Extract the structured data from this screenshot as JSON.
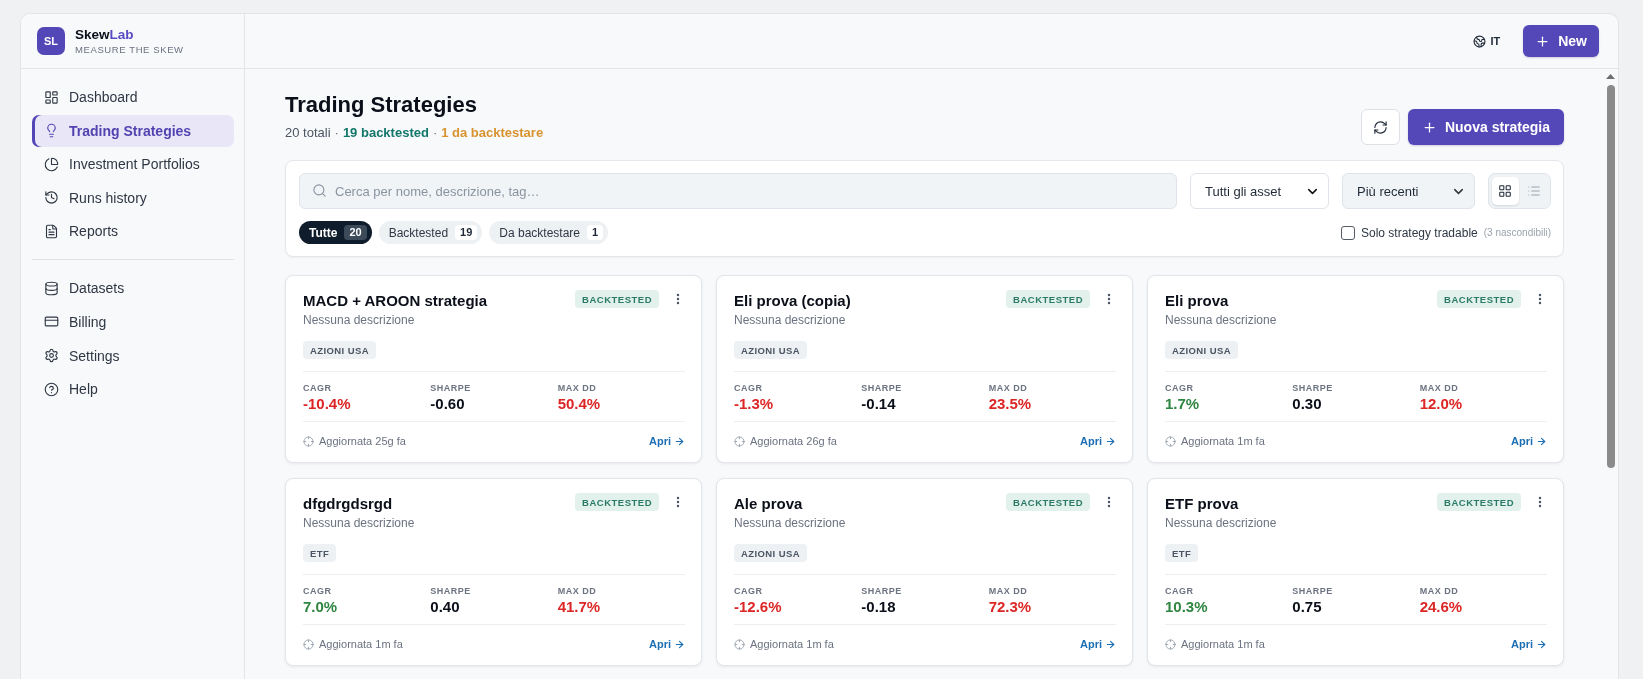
{
  "sidebar": {
    "brand": {
      "logo": "SL",
      "name": "Skew",
      "name_accent": "Lab",
      "tagline": "MEASURE THE SKEW"
    },
    "nav_groups": [
      {
        "items": [
          {
            "label": "Dashboard",
            "selected": false
          },
          {
            "label": "Trading Strategies",
            "selected": true
          },
          {
            "label": "Investment Portfolios",
            "selected": false
          },
          {
            "label": "Runs history",
            "selected": false
          },
          {
            "label": "Reports",
            "selected": false
          }
        ]
      },
      {
        "items": [
          {
            "label": "Datasets",
            "selected": false
          },
          {
            "label": "Billing",
            "selected": false
          },
          {
            "label": "Settings",
            "selected": false
          },
          {
            "label": "Help",
            "selected": false
          }
        ]
      }
    ]
  },
  "topbar": {
    "language": "IT",
    "new_button": "New"
  },
  "page": {
    "title": "Trading Strategies",
    "summary": {
      "separator": "·",
      "parts": [
        {
          "kind": "total",
          "text": "20 totali"
        },
        {
          "kind": "backtested",
          "text": "19 backtested"
        },
        {
          "kind": "pending",
          "text": "1 da backtestare"
        }
      ]
    },
    "new_strategy_button": "Nuova strategia"
  },
  "filters": {
    "search": {
      "placeholder": "Cerca per nome, descrizione, tag…"
    },
    "asset_filter": {
      "value": "Tutti gli asset"
    },
    "sort": {
      "value": "Più recenti"
    },
    "view_modes": [
      {
        "kind": "grid",
        "selected": true
      },
      {
        "kind": "list",
        "selected": false
      }
    ],
    "status_chips": [
      {
        "label": "Tutte",
        "count": "20",
        "selected": true
      },
      {
        "label": "Backtested",
        "count": "19",
        "selected": false
      },
      {
        "label": "Da backtestare",
        "count": "1",
        "selected": false
      }
    ],
    "tradable_filter": {
      "label": "Solo strategy tradable",
      "hint": "(3 nascondibili)",
      "checked": false
    }
  },
  "cards": [
    {
      "title": "MACD + AROON strategia",
      "description": "Nessuna descrizione",
      "status": {
        "kind": "backtested",
        "label": "BACKTESTED"
      },
      "tags": [
        "AZIONI USA"
      ],
      "metrics": [
        {
          "label": "CAGR",
          "value": "-10.4%",
          "color": "#dc2626"
        },
        {
          "label": "SHARPE",
          "value": "-0.60",
          "color": "#0b0f19"
        },
        {
          "label": "MAX DD",
          "value": "50.4%",
          "color": "#dc2626"
        }
      ],
      "updated": "Aggiornata 25g fa",
      "link": "Apri"
    },
    {
      "title": "Eli prova (copia)",
      "description": "Nessuna descrizione",
      "status": {
        "kind": "backtested",
        "label": "BACKTESTED"
      },
      "tags": [
        "AZIONI USA"
      ],
      "metrics": [
        {
          "label": "CAGR",
          "value": "-1.3%",
          "color": "#dc2626"
        },
        {
          "label": "SHARPE",
          "value": "-0.14",
          "color": "#0b0f19"
        },
        {
          "label": "MAX DD",
          "value": "23.5%",
          "color": "#dc2626"
        }
      ],
      "updated": "Aggiornata 26g fa",
      "link": "Apri"
    },
    {
      "title": "Eli prova",
      "description": "Nessuna descrizione",
      "status": {
        "kind": "backtested",
        "label": "BACKTESTED"
      },
      "tags": [
        "AZIONI USA"
      ],
      "metrics": [
        {
          "label": "CAGR",
          "value": "1.7%",
          "color": "#2e8540"
        },
        {
          "label": "SHARPE",
          "value": "0.30",
          "color": "#0b0f19"
        },
        {
          "label": "MAX DD",
          "value": "12.0%",
          "color": "#dc2626"
        }
      ],
      "updated": "Aggiornata 1m fa",
      "link": "Apri"
    },
    {
      "title": "dfgdrgdsrgd",
      "description": "Nessuna descrizione",
      "status": {
        "kind": "backtested",
        "label": "BACKTESTED"
      },
      "tags": [
        "ETF"
      ],
      "metrics": [
        {
          "label": "CAGR",
          "value": "7.0%",
          "color": "#2e8540"
        },
        {
          "label": "SHARPE",
          "value": "0.40",
          "color": "#0b0f19"
        },
        {
          "label": "MAX DD",
          "value": "41.7%",
          "color": "#dc2626"
        }
      ],
      "updated": "Aggiornata 1m fa",
      "link": "Apri"
    },
    {
      "title": "Ale prova",
      "description": "Nessuna descrizione",
      "status": {
        "kind": "backtested",
        "label": "BACKTESTED"
      },
      "tags": [
        "AZIONI USA"
      ],
      "metrics": [
        {
          "label": "CAGR",
          "value": "-12.6%",
          "color": "#dc2626"
        },
        {
          "label": "SHARPE",
          "value": "-0.18",
          "color": "#0b0f19"
        },
        {
          "label": "MAX DD",
          "value": "72.3%",
          "color": "#dc2626"
        }
      ],
      "updated": "Aggiornata 1m fa",
      "link": "Apri"
    },
    {
      "title": "ETF prova",
      "description": "Nessuna descrizione",
      "status": {
        "kind": "backtested",
        "label": "BACKTESTED"
      },
      "tags": [
        "ETF"
      ],
      "metrics": [
        {
          "label": "CAGR",
          "value": "10.3%",
          "color": "#2e8540"
        },
        {
          "label": "SHARPE",
          "value": "0.75",
          "color": "#0b0f19"
        },
        {
          "label": "MAX DD",
          "value": "24.6%",
          "color": "#dc2626"
        }
      ],
      "updated": "Aggiornata 1m fa",
      "link": "Apri"
    }
  ]
}
